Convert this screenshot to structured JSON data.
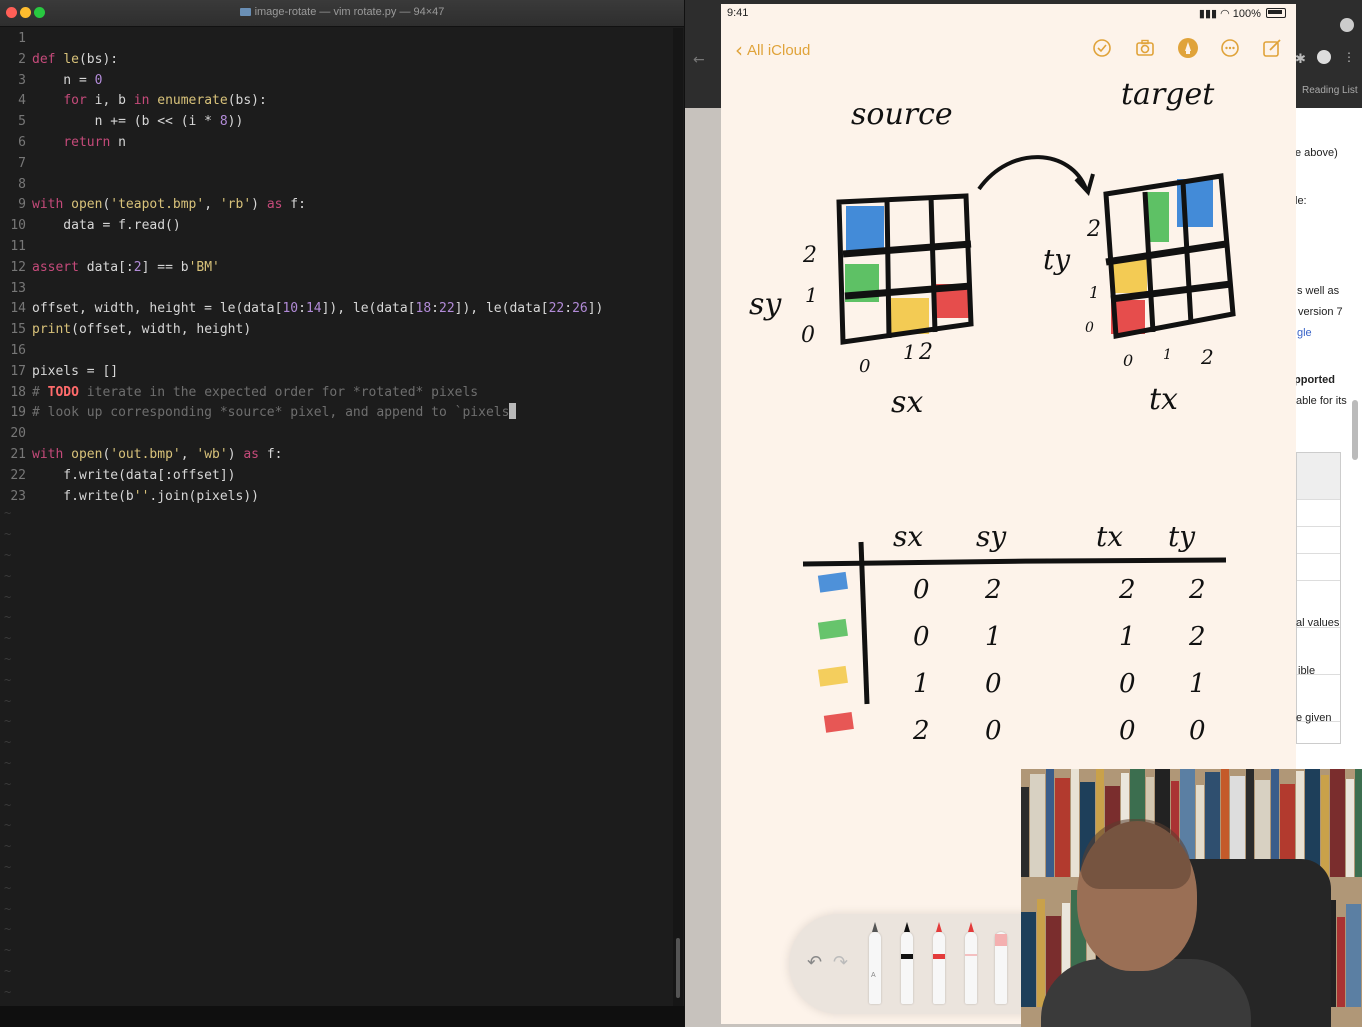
{
  "terminal": {
    "title": "image-rotate — vim rotate.py — 94×47",
    "lines": [
      {
        "n": "1",
        "parts": [
          {
            "t": "",
            "c": ""
          }
        ]
      },
      {
        "n": "2",
        "parts": [
          {
            "t": "def",
            "c": "kw"
          },
          {
            "t": " ",
            "c": ""
          },
          {
            "t": "le",
            "c": "fn"
          },
          {
            "t": "(bs):",
            "c": ""
          }
        ]
      },
      {
        "n": "3",
        "parts": [
          {
            "t": "    n = ",
            "c": ""
          },
          {
            "t": "0",
            "c": "num"
          }
        ]
      },
      {
        "n": "4",
        "parts": [
          {
            "t": "    ",
            "c": ""
          },
          {
            "t": "for",
            "c": "kw"
          },
          {
            "t": " i, b ",
            "c": ""
          },
          {
            "t": "in",
            "c": "kw"
          },
          {
            "t": " ",
            "c": ""
          },
          {
            "t": "enumerate",
            "c": "fn"
          },
          {
            "t": "(bs):",
            "c": ""
          }
        ]
      },
      {
        "n": "5",
        "parts": [
          {
            "t": "        n += (b << (i * ",
            "c": ""
          },
          {
            "t": "8",
            "c": "num"
          },
          {
            "t": "))",
            "c": ""
          }
        ]
      },
      {
        "n": "6",
        "parts": [
          {
            "t": "    ",
            "c": ""
          },
          {
            "t": "return",
            "c": "kw"
          },
          {
            "t": " n",
            "c": ""
          }
        ]
      },
      {
        "n": "7",
        "parts": [
          {
            "t": "",
            "c": ""
          }
        ]
      },
      {
        "n": "8",
        "parts": [
          {
            "t": "",
            "c": ""
          }
        ]
      },
      {
        "n": "9",
        "parts": [
          {
            "t": "with",
            "c": "kw"
          },
          {
            "t": " ",
            "c": ""
          },
          {
            "t": "open",
            "c": "fn"
          },
          {
            "t": "(",
            "c": ""
          },
          {
            "t": "'teapot.bmp'",
            "c": "str"
          },
          {
            "t": ", ",
            "c": ""
          },
          {
            "t": "'rb'",
            "c": "str"
          },
          {
            "t": ") ",
            "c": ""
          },
          {
            "t": "as",
            "c": "kw"
          },
          {
            "t": " f:",
            "c": ""
          }
        ]
      },
      {
        "n": "10",
        "parts": [
          {
            "t": "    data = f.read()",
            "c": ""
          }
        ]
      },
      {
        "n": "11",
        "parts": [
          {
            "t": "",
            "c": ""
          }
        ]
      },
      {
        "n": "12",
        "parts": [
          {
            "t": "assert",
            "c": "kw"
          },
          {
            "t": " data[:",
            "c": ""
          },
          {
            "t": "2",
            "c": "num"
          },
          {
            "t": "] == b",
            "c": ""
          },
          {
            "t": "'BM'",
            "c": "str"
          }
        ]
      },
      {
        "n": "13",
        "parts": [
          {
            "t": "",
            "c": ""
          }
        ]
      },
      {
        "n": "14",
        "parts": [
          {
            "t": "offset, width, height = le(data[",
            "c": ""
          },
          {
            "t": "10",
            "c": "num"
          },
          {
            "t": ":",
            "c": ""
          },
          {
            "t": "14",
            "c": "num"
          },
          {
            "t": "]), le(data[",
            "c": ""
          },
          {
            "t": "18",
            "c": "num"
          },
          {
            "t": ":",
            "c": ""
          },
          {
            "t": "22",
            "c": "num"
          },
          {
            "t": "]), le(data[",
            "c": ""
          },
          {
            "t": "22",
            "c": "num"
          },
          {
            "t": ":",
            "c": ""
          },
          {
            "t": "26",
            "c": "num"
          },
          {
            "t": "])",
            "c": ""
          }
        ]
      },
      {
        "n": "15",
        "parts": [
          {
            "t": "print",
            "c": "fn"
          },
          {
            "t": "(offset, width, height)",
            "c": ""
          }
        ]
      },
      {
        "n": "16",
        "parts": [
          {
            "t": "",
            "c": ""
          }
        ]
      },
      {
        "n": "17",
        "parts": [
          {
            "t": "pixels = []",
            "c": ""
          }
        ]
      },
      {
        "n": "18",
        "parts": [
          {
            "t": "# ",
            "c": "cm"
          },
          {
            "t": "TODO",
            "c": "todo"
          },
          {
            "t": " iterate in the expected order for *rotated* pixels",
            "c": "cm"
          }
        ]
      },
      {
        "n": "19",
        "parts": [
          {
            "t": "# look up corresponding *source* pixel, and append to `pixels",
            "c": "cm"
          },
          {
            "t": "`",
            "c": "cursor"
          }
        ]
      },
      {
        "n": "20",
        "parts": [
          {
            "t": "",
            "c": ""
          }
        ]
      },
      {
        "n": "21",
        "parts": [
          {
            "t": "with",
            "c": "kw"
          },
          {
            "t": " ",
            "c": ""
          },
          {
            "t": "open",
            "c": "fn"
          },
          {
            "t": "(",
            "c": ""
          },
          {
            "t": "'out.bmp'",
            "c": "str"
          },
          {
            "t": ", ",
            "c": ""
          },
          {
            "t": "'wb'",
            "c": "str"
          },
          {
            "t": ") ",
            "c": ""
          },
          {
            "t": "as",
            "c": "kw"
          },
          {
            "t": " f:",
            "c": ""
          }
        ]
      },
      {
        "n": "22",
        "parts": [
          {
            "t": "    f.write(data[:offset])",
            "c": ""
          }
        ]
      },
      {
        "n": "23",
        "parts": [
          {
            "t": "    f.write(b",
            "c": ""
          },
          {
            "t": "''",
            "c": "str"
          },
          {
            "t": ".join(pixels))",
            "c": ""
          }
        ]
      }
    ],
    "tilde": "~"
  },
  "browser": {
    "reading_list": "Reading List",
    "snippets": [
      {
        "text": "e above)",
        "cls": ""
      },
      {
        "text": "le:",
        "cls": ""
      },
      {
        "text": "s well as",
        "cls": ""
      },
      {
        "text": "version 7",
        "cls": ""
      },
      {
        "text": "gle",
        "cls": "bc-link"
      },
      {
        "text": "pported",
        "cls": "bc-bold"
      },
      {
        "text": "able for its",
        "cls": ""
      },
      {
        "text": "al values",
        "cls": ""
      },
      {
        "text": "ible",
        "cls": ""
      },
      {
        "text": "e given",
        "cls": ""
      }
    ]
  },
  "ipad": {
    "time": "9:41",
    "battery": "100%",
    "back_label": "All iCloud",
    "accent": "#e0a33a",
    "drawing": {
      "source_title": "source",
      "target_title": "target",
      "sy_label": "sy",
      "sx_label": "sx",
      "ty_label": "ty",
      "tx_label": "tx",
      "src_y_ticks": [
        "2",
        "1",
        "0"
      ],
      "src_x_ticks": [
        "0",
        "1",
        "2"
      ],
      "tgt_y_ticks": [
        "2",
        "1",
        "0"
      ],
      "tgt_x_ticks": [
        "0",
        "1",
        "2"
      ],
      "table_headers": [
        "sx",
        "sy",
        "tx",
        "ty"
      ],
      "table_rows": [
        {
          "color": "#2f7fd6",
          "cells": [
            "0",
            "2",
            "2",
            "2"
          ]
        },
        {
          "color": "#4cbb56",
          "cells": [
            "0",
            "1",
            "1",
            "2"
          ]
        },
        {
          "color": "#f2c744",
          "cells": [
            "1",
            "0",
            "0",
            "1"
          ]
        },
        {
          "color": "#e33b3b",
          "cells": [
            "2",
            "0",
            "0",
            "0"
          ]
        }
      ]
    }
  }
}
